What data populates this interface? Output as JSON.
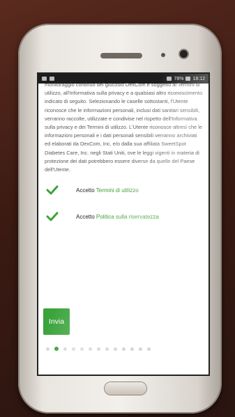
{
  "status_bar": {
    "right_text": "78%",
    "time": "18:12"
  },
  "terms_text": "monitoraggio continuo del glucosio DexCom e soggetto ai Termini di utilizzo, all'Informativa sulla privacy e a qualsiasi altro riconoscimento indicato di seguito. Selezionando le caselle sottostanti, l'Utente riconosce che le informazioni personali, inclusi dati sanitari sensibili, verranno raccolte, utilizzate e condivise nel rispetto dell'Informativa sulla privacy e dei Termini di utilizzo. L'Utente riconosce altresì che le informazioni personali e i dati personali sensibili verranno archiviati ed elaborati da DexCom, Inc. e/o dalla sua affiliata SweetSpot Diabetes Care, Inc. negli Stati Uniti, ove le leggi vigenti in materia di protezione dei dati potrebbero essere diverse da quelle del Paese dell'Utente.",
  "consents": [
    {
      "prefix": "Accetto",
      "link": "Termini di utilizzo",
      "checked": true
    },
    {
      "prefix": "Accetto",
      "link": "Politica sulla riservatezza",
      "checked": true
    }
  ],
  "send_button": "Invia",
  "pager": {
    "total": 13,
    "active_index": 1
  },
  "colors": {
    "accent": "#3aa33a",
    "link": "#3a9b2e"
  }
}
